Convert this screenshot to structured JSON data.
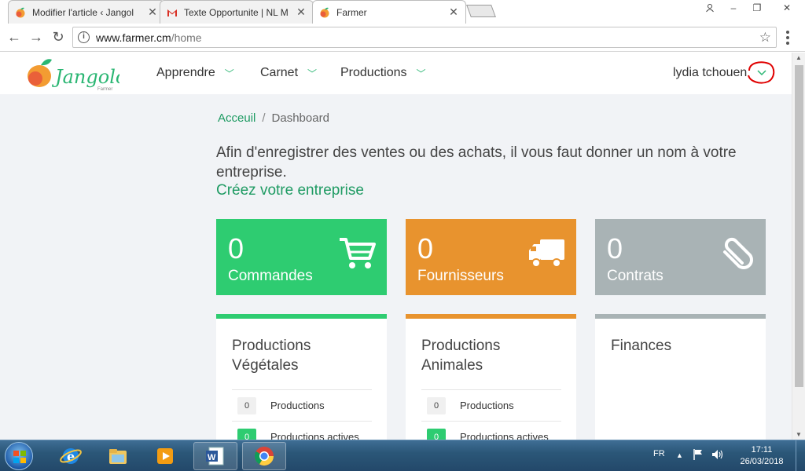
{
  "browser": {
    "tabs": [
      {
        "title": "Modifier l'article ‹ Jangol",
        "icon": "mango-favicon",
        "active": false
      },
      {
        "title": "Texte Opportunite | NL M",
        "icon": "gmail-favicon",
        "active": false
      },
      {
        "title": "Farmer",
        "icon": "mango-favicon",
        "active": true
      }
    ],
    "url_host": "www.farmer.cm",
    "url_path": "/home"
  },
  "site": {
    "logo_text": "Jangolo",
    "logo_sub": "Farmer",
    "nav": [
      {
        "label": "Apprendre"
      },
      {
        "label": "Carnet"
      },
      {
        "label": "Productions"
      }
    ],
    "user_name": "lydia tchouen"
  },
  "breadcrumb": {
    "home": "Acceuil",
    "separator": "/",
    "current": "Dashboard"
  },
  "notice": {
    "text": "Afin d'enregistrer des ventes ou des achats, il vous faut donner un nom à votre entreprise.",
    "link": "Créez votre entreprise"
  },
  "stats": [
    {
      "value": "0",
      "label": "Commandes",
      "color": "#2ecc71",
      "icon": "shopping-cart-icon"
    },
    {
      "value": "0",
      "label": "Fournisseurs",
      "color": "#e8932e",
      "icon": "truck-icon"
    },
    {
      "value": "0",
      "label": "Contrats",
      "color": "#a9b3b5",
      "icon": "paperclip-icon"
    }
  ],
  "cards": [
    {
      "title": "Productions Végétales",
      "color": "#2ecc71",
      "rows": [
        {
          "count": "0",
          "label": "Productions"
        },
        {
          "count": "0",
          "label": "Productions actives"
        }
      ]
    },
    {
      "title": "Productions Animales",
      "color": "#e8932e",
      "rows": [
        {
          "count": "0",
          "label": "Productions"
        },
        {
          "count": "0",
          "label": "Productions actives"
        }
      ]
    },
    {
      "title": "Finances",
      "color": "#a9b3b5",
      "rows": []
    }
  ],
  "taskbar": {
    "language": "FR",
    "time": "17:11",
    "date": "26/03/2018"
  },
  "colors": {
    "brand_green": "#1f9b63",
    "accent_green": "#2ecc71",
    "accent_orange": "#e8932e",
    "accent_grey": "#a9b3b5"
  }
}
